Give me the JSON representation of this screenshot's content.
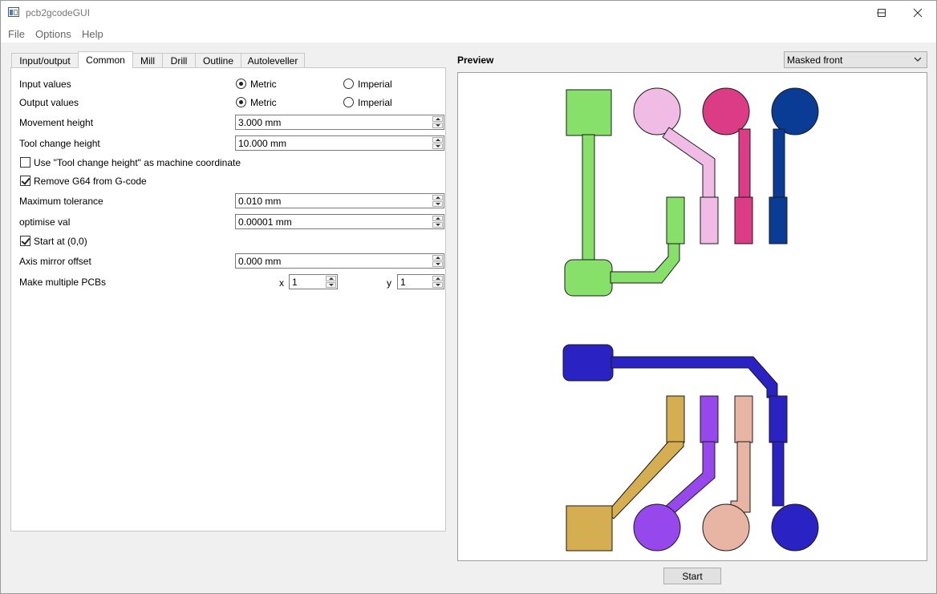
{
  "window": {
    "title": "pcb2gcodeGUI"
  },
  "menu": {
    "file": "File",
    "options": "Options",
    "help": "Help"
  },
  "tabs": [
    "Input/output",
    "Common",
    "Mill",
    "Drill",
    "Outline",
    "Autoleveller"
  ],
  "active_tab": "Common",
  "common": {
    "input_values_label": "Input values",
    "output_values_label": "Output values",
    "metric": "Metric",
    "imperial": "Imperial",
    "input_values_selected": "Metric",
    "output_values_selected": "Metric",
    "movement_height_label": "Movement height",
    "movement_height_value": "3.000 mm",
    "tool_change_height_label": "Tool change height",
    "tool_change_height_value": "10.000 mm",
    "use_machine_coordinate_label": "Use \"Tool change height\" as machine coordinate",
    "use_machine_coordinate_checked": false,
    "remove_g64_label": "Remove G64 from G-code",
    "remove_g64_checked": true,
    "max_tolerance_label": "Maximum tolerance",
    "max_tolerance_value": "0.010 mm",
    "optimise_label": "optimise val",
    "optimise_value": "0.00001 mm",
    "start_at_origin_label": "Start at (0,0)",
    "start_at_origin_checked": true,
    "axis_mirror_label": "Axis mirror offset",
    "axis_mirror_value": "0.000 mm",
    "multiple_pcbs_label": "Make multiple PCBs",
    "x_label": "x",
    "x_value": "1",
    "y_label": "y",
    "y_value": "1"
  },
  "preview": {
    "title": "Preview",
    "mode": "Masked front"
  },
  "start_button": "Start",
  "colors": {
    "green": "#86e06a",
    "light_pink": "#f0bce6",
    "magenta": "#dc3c86",
    "navy": "#0a3c96",
    "blue_violet": "#2a22c2",
    "gold": "#d6ae52",
    "purple": "#9748ec",
    "salmon": "#e8b4a4"
  }
}
